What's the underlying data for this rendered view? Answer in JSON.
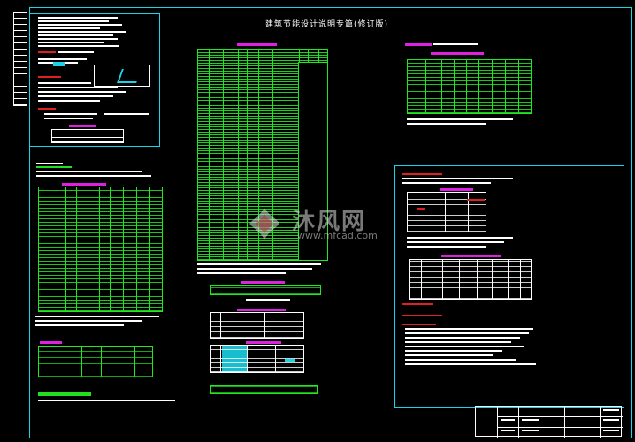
{
  "drawing": {
    "title": "建筑节能设计说明专篇(修订版)"
  },
  "watermark": {
    "brand": "沐风网",
    "url": "www.mfcad.com"
  },
  "colors": {
    "frame": "#1ad3e6",
    "table_lines": "#1fe81f",
    "heading_bar": "#e020e0",
    "highlight_bar": "#e02020",
    "text_lines": "#ffffff",
    "background": "#000000"
  }
}
